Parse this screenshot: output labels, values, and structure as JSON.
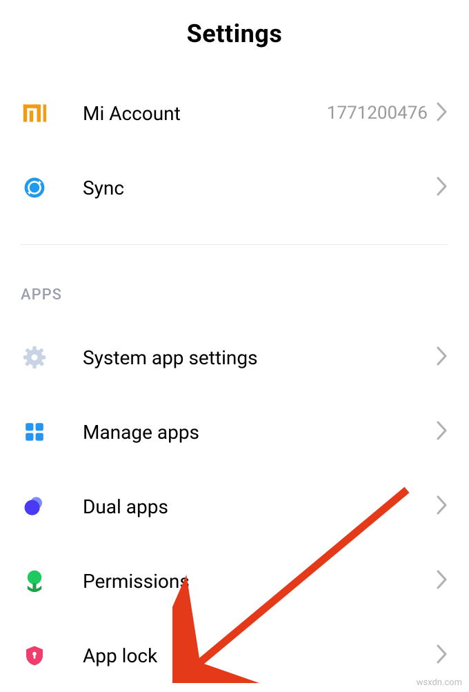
{
  "header": {
    "title": "Settings"
  },
  "account_section": {
    "items": [
      {
        "label": "Mi Account",
        "value": "1771200476"
      },
      {
        "label": "Sync",
        "value": ""
      }
    ]
  },
  "apps_section": {
    "header": "APPS",
    "items": [
      {
        "label": "System app settings"
      },
      {
        "label": "Manage apps"
      },
      {
        "label": "Dual apps"
      },
      {
        "label": "Permissions"
      },
      {
        "label": "App lock"
      }
    ]
  },
  "watermark": "wsxdn.com"
}
